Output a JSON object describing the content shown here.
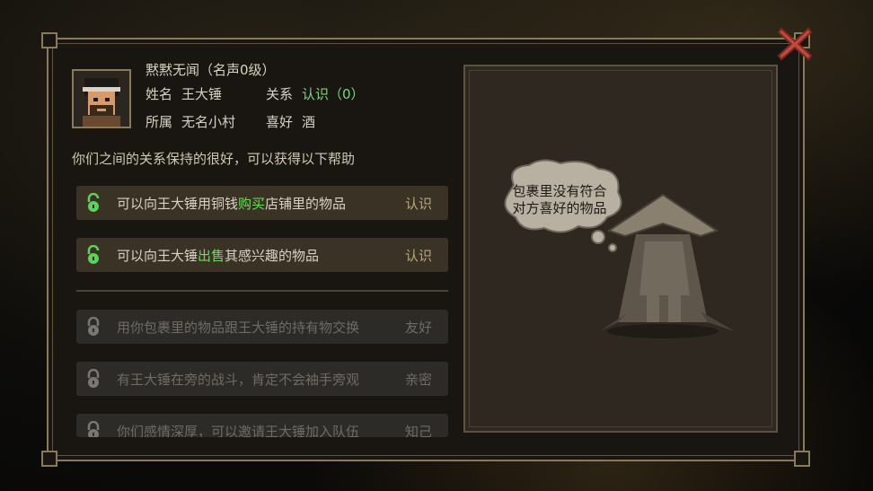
{
  "npc": {
    "title": "黙黙无闻（名声0级）",
    "name_label": "姓名",
    "name_value": "王大锤",
    "relation_label": "关系",
    "relation_value": "认识（0）",
    "home_label": "所属",
    "home_value": "无名小村",
    "hobby_label": "喜好",
    "hobby_value": "酒"
  },
  "hint": "你们之间的关系保持的很好，可以获得以下帮助",
  "perks": [
    {
      "pre": "可以向王大锤用铜钱",
      "hl": "购买",
      "post": "店铺里的物品",
      "tier": "认识",
      "unlocked": true
    },
    {
      "pre": "可以向王大锤",
      "hl": "出售",
      "post": "其感兴趣的物品",
      "tier": "认识",
      "unlocked": true
    },
    {
      "pre": "用你包裹里的物品跟王大锤的持有物交换",
      "hl": "",
      "post": "",
      "tier": "友好",
      "unlocked": false
    },
    {
      "pre": "有王大锤在旁的战斗，肯定不会袖手旁观",
      "hl": "",
      "post": "",
      "tier": "亲密",
      "unlocked": false
    },
    {
      "pre": "你们感情深厚，可以邀请王大锤加入队伍",
      "hl": "",
      "post": "",
      "tier": "知己",
      "unlocked": false
    }
  ],
  "bubble": {
    "line1": "包裹里没有符合",
    "line2": "对方喜好的物品"
  },
  "colors": {
    "accent_green": "#6cdd5c",
    "frame": "#8a7a5c",
    "close_red": "#c0392b"
  },
  "icons": {
    "close": "close-x-icon",
    "unlocked": "unlocked-padlock-icon",
    "locked": "locked-padlock-icon"
  }
}
